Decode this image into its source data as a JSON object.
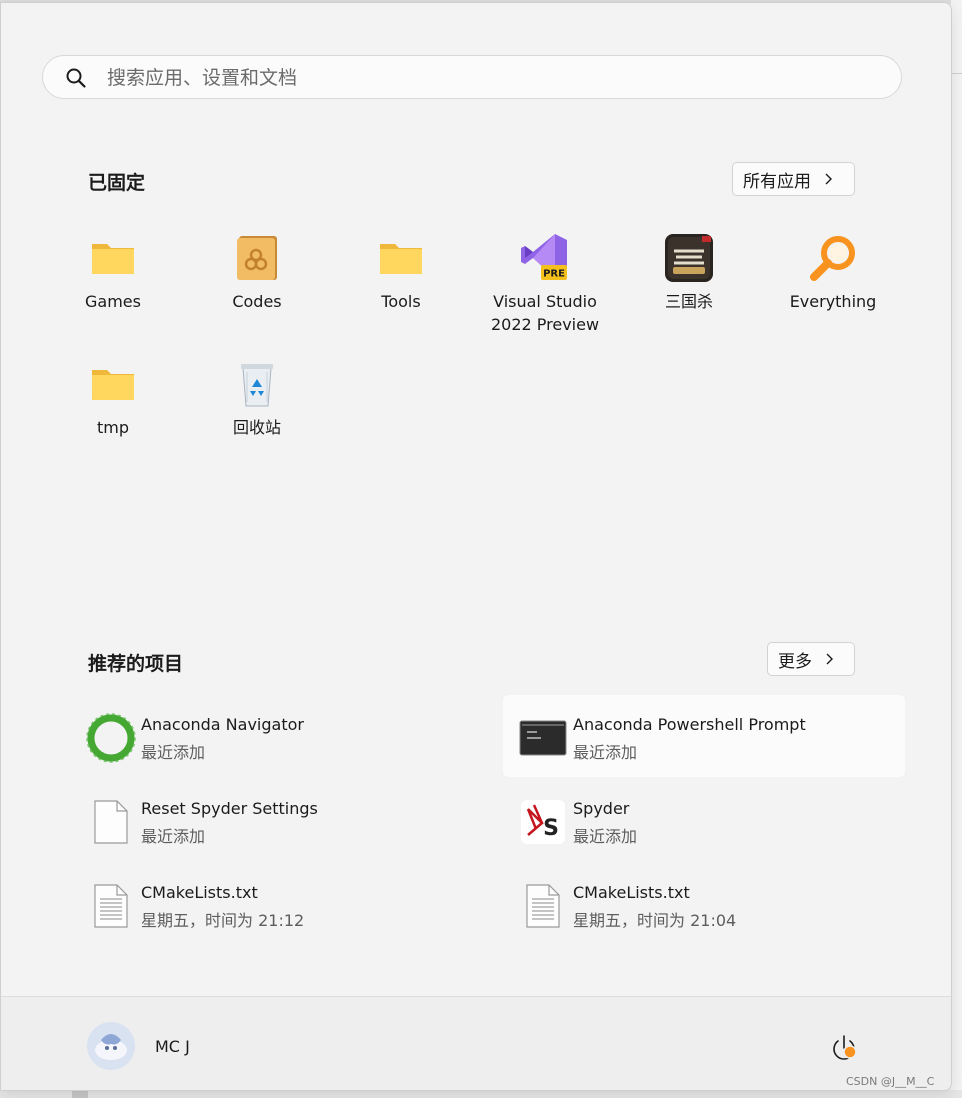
{
  "search": {
    "placeholder": "搜索应用、设置和文档"
  },
  "pinned": {
    "title": "已固定",
    "all_apps_label": "所有应用",
    "items": [
      {
        "label": "Games",
        "icon": "folder-icon"
      },
      {
        "label": "Codes",
        "icon": "codes-folder-icon"
      },
      {
        "label": "Tools",
        "icon": "folder-icon"
      },
      {
        "label": "Visual Studio\n2022 Preview",
        "icon": "visual-studio-preview-icon",
        "badge": "PRE"
      },
      {
        "label": "三国杀",
        "icon": "sanguosha-icon"
      },
      {
        "label": "Everything",
        "icon": "everything-search-icon"
      },
      {
        "label": "tmp",
        "icon": "folder-icon"
      },
      {
        "label": "回收站",
        "icon": "recycle-bin-icon"
      }
    ]
  },
  "recommended": {
    "title": "推荐的项目",
    "more_label": "更多",
    "items": [
      {
        "name": "Anaconda Navigator",
        "sub": "最近添加",
        "icon": "anaconda-icon"
      },
      {
        "name": "Anaconda Powershell Prompt",
        "sub": "最近添加",
        "icon": "terminal-icon"
      },
      {
        "name": "Reset Spyder Settings",
        "sub": "最近添加",
        "icon": "blank-file-icon"
      },
      {
        "name": "Spyder",
        "sub": "最近添加",
        "icon": "spyder-icon"
      },
      {
        "name": "CMakeLists.txt",
        "sub": "星期五，时间为 21:12",
        "icon": "text-file-icon"
      },
      {
        "name": "CMakeLists.txt",
        "sub": "星期五，时间为 21:04",
        "icon": "text-file-icon"
      }
    ]
  },
  "user": {
    "name": "MC J"
  },
  "watermark": "CSDN @J__M__C",
  "colors": {
    "accent_orange": "#f7931e",
    "folder_yellow": "#ffd75e",
    "anaconda_green": "#44a833",
    "vs_purple": "#7b4fd6"
  }
}
